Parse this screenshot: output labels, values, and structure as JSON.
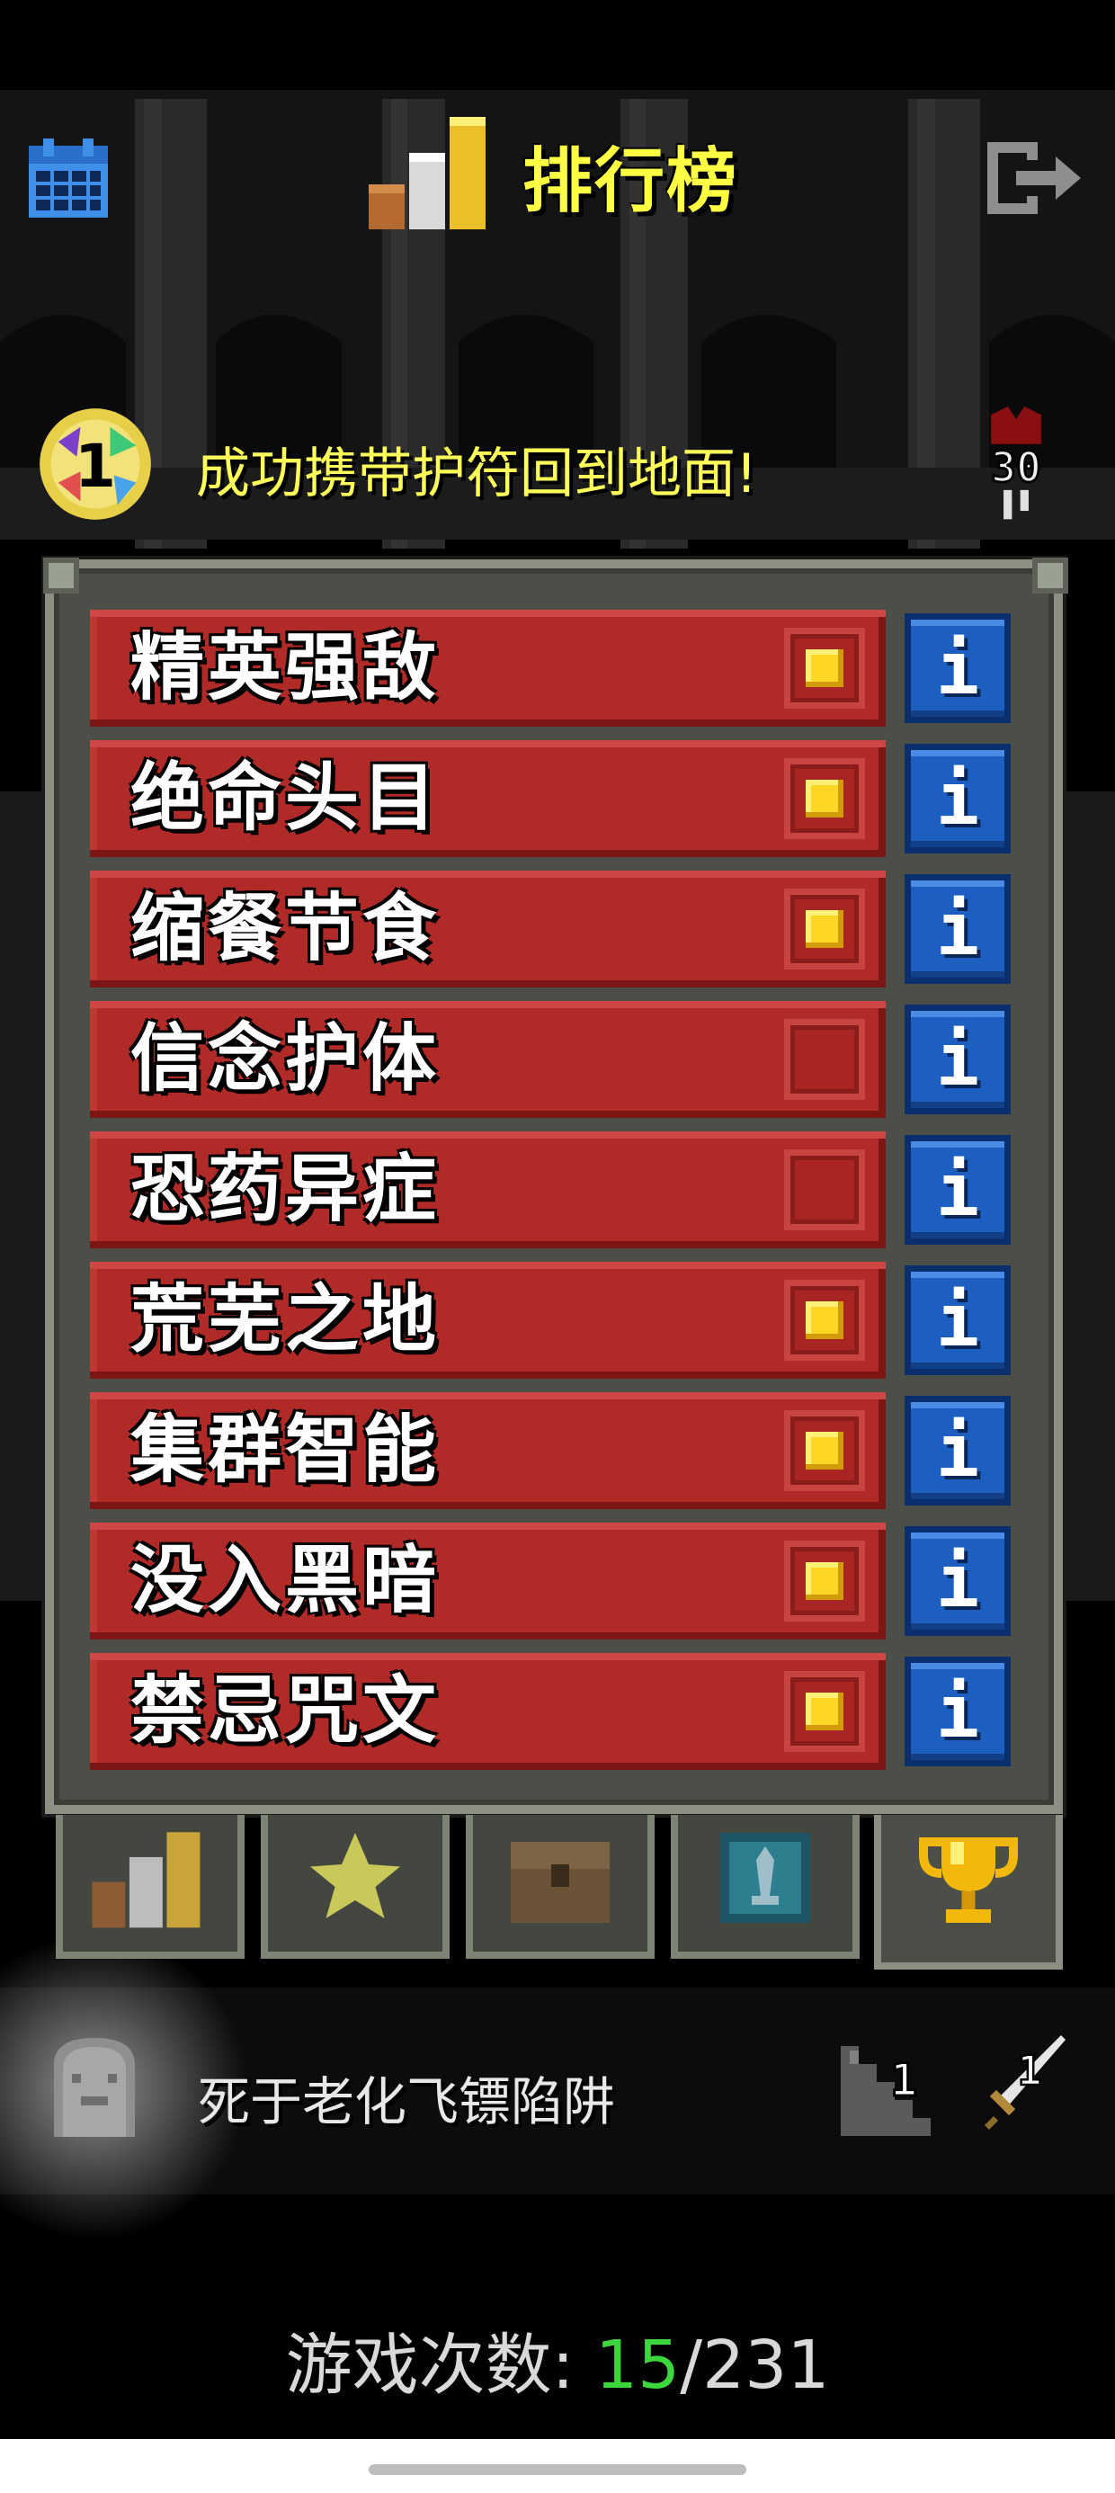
{
  "header": {
    "title": "排行榜",
    "left_icon": "calendar-icon",
    "right_icon": "exit-icon"
  },
  "record": {
    "badge_value": "1",
    "text": "成功携带护符回到地面!",
    "depth": "30"
  },
  "challenges": [
    {
      "label": "精英强敌",
      "checked": true
    },
    {
      "label": "绝命头目",
      "checked": true
    },
    {
      "label": "缩餐节食",
      "checked": true
    },
    {
      "label": "信念护体",
      "checked": false
    },
    {
      "label": "恐药异症",
      "checked": false
    },
    {
      "label": "荒芜之地",
      "checked": true
    },
    {
      "label": "集群智能",
      "checked": true
    },
    {
      "label": "没入黑暗",
      "checked": true
    },
    {
      "label": "禁忌咒文",
      "checked": true
    }
  ],
  "tabs": [
    {
      "icon": "rankings-bars-icon"
    },
    {
      "icon": "star-icon"
    },
    {
      "icon": "chest-icon"
    },
    {
      "icon": "armor-shield-icon"
    },
    {
      "icon": "trophy-icon",
      "active": true
    }
  ],
  "death": {
    "text": "死于老化飞镖陷阱",
    "depth": "1",
    "weapon_level": "1"
  },
  "games": {
    "label": "游戏次数:",
    "won": "15",
    "separator": "/",
    "total": "231"
  },
  "colors": {
    "title_yellow": "#ffff44",
    "row_red": "#b02a28",
    "info_blue": "#1d5fc0",
    "highlight_green": "#3dd63d"
  }
}
